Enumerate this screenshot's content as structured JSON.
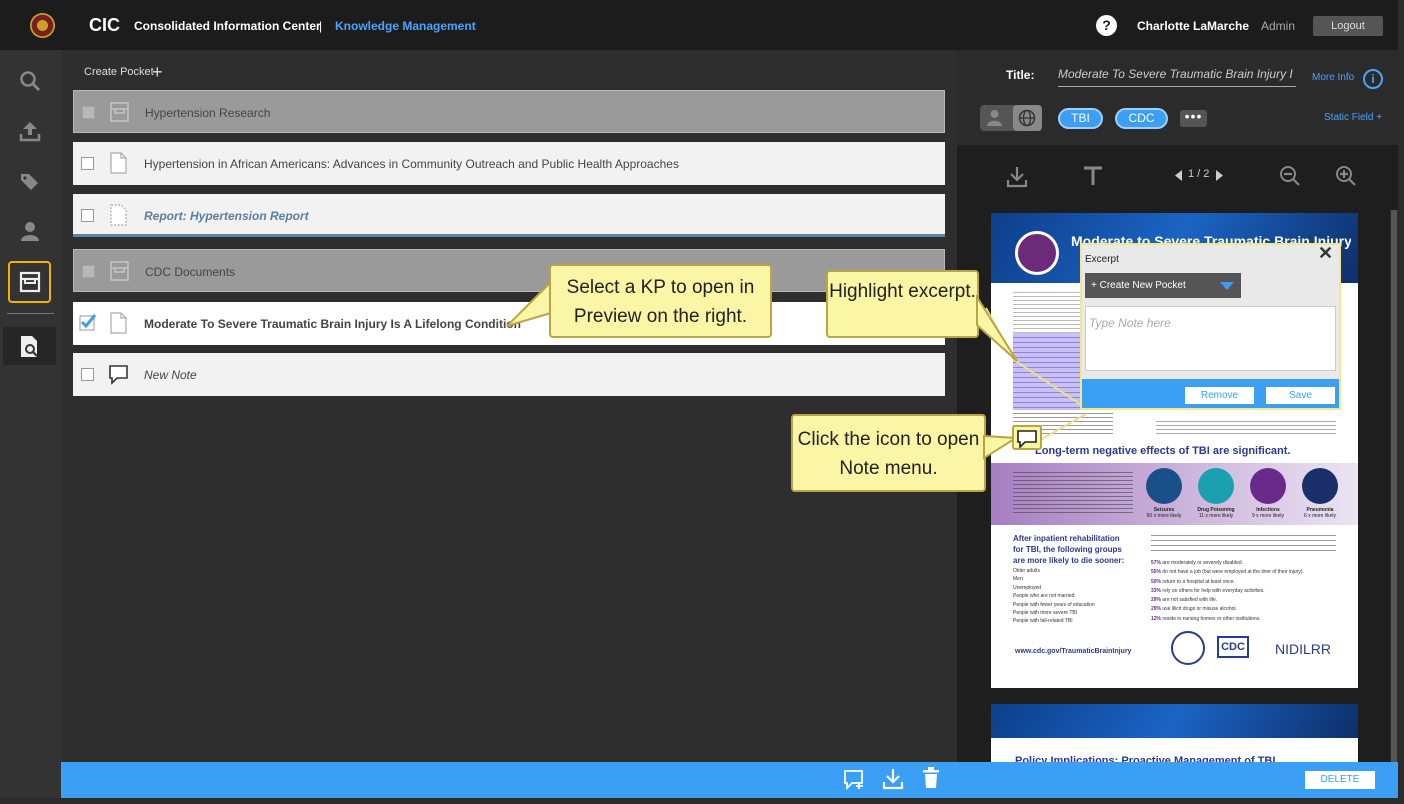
{
  "header": {
    "app_short": "CIC",
    "app_full": "Consolidated Information Center",
    "separator": "|",
    "module": "Knowledge Management",
    "help": "?",
    "user": "Charlotte LaMarche",
    "role": "Admin",
    "logout": "Logout"
  },
  "sidebar": {
    "items": [
      "search-icon",
      "upload-icon",
      "tags-icon",
      "user-icon",
      "pocket-icon",
      "preview-icon"
    ],
    "active": "pocket-icon"
  },
  "list": {
    "create_label": "Create Pocket",
    "rows": [
      {
        "type": "pocket",
        "label": "Hypertension Research",
        "checked": false
      },
      {
        "type": "document",
        "label": "Hypertension in African Americans: Advances in Community Outreach and Public Health Approaches",
        "checked": false
      },
      {
        "type": "report",
        "label": "Report: Hypertension Report",
        "checked": false
      },
      {
        "type": "pocket",
        "label": "CDC Documents",
        "checked": false
      },
      {
        "type": "document",
        "label": "Moderate To Severe Traumatic Brain Injury Is A Lifelong Condition",
        "checked": true
      },
      {
        "type": "note",
        "label": "New Note",
        "checked": false
      }
    ]
  },
  "preview": {
    "title_label": "Title:",
    "title_value": "Moderate To Severe Traumatic Brain Injury I",
    "more_info": "More Info",
    "tags": [
      "TBI",
      "CDC"
    ],
    "tag_more": "•••",
    "static_field": "Static Field +",
    "page_indicator": "1 / 2",
    "delete_label": "DELETE",
    "page1": {
      "heading": "Moderate to Severe Traumatic Brain Injury",
      "subhead": "Long-term negative effects of TBI are significant.",
      "stats": [
        {
          "label": "Seizures",
          "value": "50 x more likely"
        },
        {
          "label": "Drug Poisoning",
          "value": "11 x more likely"
        },
        {
          "label": "Infections",
          "value": "9 x more likely"
        },
        {
          "label": "Pneumonia",
          "value": "6 x more likely"
        }
      ],
      "left_heading": "After inpatient rehabilitation for TBI, the following groups are more likely to die sooner:",
      "left_list": [
        "Older adults",
        "Men",
        "Unemployed",
        "People who are not married",
        "People with fewer years of education",
        "People with more severe TBI",
        "People with fall-related TBI"
      ],
      "right_stats": [
        {
          "pct": "57%",
          "text": "are moderately or severely disabled."
        },
        {
          "pct": "55%",
          "text": "do not have a job (but were employed at the time of their injury)."
        },
        {
          "pct": "50%",
          "text": "return to a hospital at least once."
        },
        {
          "pct": "33%",
          "text": "rely on others for help with everyday activities."
        },
        {
          "pct": "29%",
          "text": "are not satisfied with life."
        },
        {
          "pct": "29%",
          "text": "use illicit drugs or misuse alcohol."
        },
        {
          "pct": "12%",
          "text": "reside in nursing homes or other institutions."
        }
      ],
      "url": "www.cdc.gov/TraumaticBrainInjury",
      "logos": [
        "CDC",
        "NIDILRR"
      ]
    },
    "page2_heading": "Policy Implications: Proactive Management of TBI"
  },
  "excerpt_popup": {
    "label": "Excerpt",
    "pocket_select": "+ Create New Pocket",
    "note_placeholder": "Type Note here",
    "remove": "Remove",
    "save": "Save"
  },
  "callouts": {
    "select_kp": "Select a KP to open in Preview on the right.",
    "highlight": "Highlight excerpt.",
    "note_icon": "Click the icon to open Note menu."
  },
  "colors": {
    "accent": "#3a9ff5",
    "callout": "#fbf5a6",
    "active_nav": "#f0b400"
  }
}
